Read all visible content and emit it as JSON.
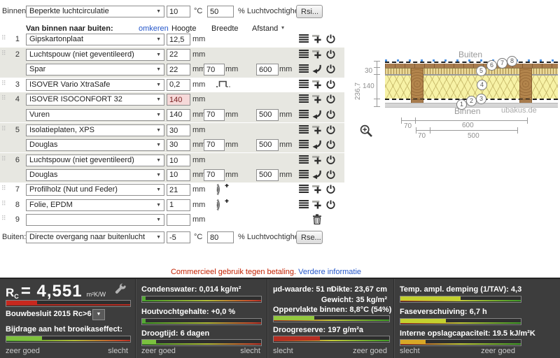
{
  "icons": {
    "select_arrow": "▼",
    "dropdown_arrow": "▼",
    "sort_arrow": "▾",
    "drag_handle": "⠿"
  },
  "binnen": {
    "label": "Binnen:",
    "select": "Beperkte luchtcirculatie",
    "temp": "10",
    "temp_unit": "°C",
    "humidity": "50",
    "humidity_label": "% Luchtvochtigheid",
    "button": "Rsi..."
  },
  "buiten": {
    "label": "Buiten:",
    "select": "Directe overgang naar buitenlucht",
    "temp": "-5",
    "temp_unit": "°C",
    "humidity": "80",
    "humidity_label": "% Luchtvochtigheid",
    "button": "Rse..."
  },
  "columns": {
    "direction": "Van binnen naar buiten:",
    "invert_link": "omkeren",
    "hoogte": "Hoogte",
    "breedte": "Breedte",
    "afstand": "Afstand",
    "unit": "mm"
  },
  "layers": [
    {
      "num": "1",
      "material": "Gipskartonplaat",
      "hoogte": "12,5"
    },
    {
      "num": "2",
      "material": "Luchtspouw (niet geventileerd)",
      "hoogte": "22"
    },
    {
      "num": "",
      "material": "Spar",
      "hoogte": "22",
      "breedte": "70",
      "afstand": "600"
    },
    {
      "num": "3",
      "material": "ISOVER Vario XtraSafe",
      "hoogte": "0,2"
    },
    {
      "num": "4",
      "material": "ISOVER ISOCONFORT 32",
      "hoogte": "140"
    },
    {
      "num": "",
      "material": "Vuren",
      "hoogte": "140",
      "breedte": "70",
      "afstand": "500"
    },
    {
      "num": "5",
      "material": "Isolatieplaten, XPS",
      "hoogte": "30"
    },
    {
      "num": "",
      "material": "Douglas",
      "hoogte": "30",
      "breedte": "70",
      "afstand": "500"
    },
    {
      "num": "6",
      "material": "Luchtspouw (niet geventileerd)",
      "hoogte": "10"
    },
    {
      "num": "",
      "material": "Douglas",
      "hoogte": "10",
      "breedte": "70",
      "afstand": "500"
    },
    {
      "num": "7",
      "material": "Profilholz (Nut und Feder)",
      "hoogte": "21"
    },
    {
      "num": "8",
      "material": "Folie, EPDM",
      "hoogte": "1"
    },
    {
      "num": "9",
      "material": "",
      "hoogte": ""
    }
  ],
  "notice": {
    "text": "Commercieel gebruik tegen betaling.",
    "link": "Verdere informatie"
  },
  "diagram": {
    "outside": "Buiten",
    "inside": "Binnen",
    "watermark": "ubakus.de",
    "total_height": "236,7",
    "dim30": "30",
    "dim140": "140",
    "row1_a": "70",
    "row1_b": "600",
    "row2_a": "70",
    "row2_b": "500",
    "markers": [
      "1",
      "2",
      "3",
      "4",
      "5",
      "6",
      "7",
      "8"
    ]
  },
  "results": {
    "col1": {
      "rc_r": "R",
      "rc_sub": "C",
      "rc_value": "= 4,551",
      "rc_unit": "m²K/W",
      "rc_bar": {
        "pct": "25%",
        "color": "#c8281e"
      },
      "bouwbesluit": "Bouwbesluit 2015 Rc>6",
      "bijdrage": "Bijdrage aan het broeikaseffect:",
      "bijdrage_bar": {
        "pct": "29%",
        "color": "#7fc13d"
      },
      "foot_left": "zeer goed",
      "foot_right": "slecht"
    },
    "col2": {
      "items": [
        {
          "label": "Condenswater: 0,014 kg/m²",
          "pct": "3%",
          "color": "#55a835"
        },
        {
          "label": "Houtvochtgehalte: +0,0 %",
          "pct": "3%",
          "color": "#55a835"
        },
        {
          "label": "Droogtijd: 6 dagen",
          "pct": "12%",
          "color": "#7cc13f"
        }
      ],
      "foot_left": "zeer goed",
      "foot_right": "slecht"
    },
    "col3": {
      "ud": "µd-waarde: 51 m",
      "dikte": "Dikte: 23,67 cm",
      "gewicht": "Gewicht: 35 kg/m²",
      "items": [
        {
          "label": "Oppervlakte binnen: 8,8°C (54%)",
          "pct": "35%",
          "color": "#93c83e"
        },
        {
          "label": "Droogreserve: 197 g/m²a",
          "pct": "40%",
          "color": "#b52e22"
        }
      ],
      "foot_left": "slecht",
      "foot_right": "zeer goed"
    },
    "col4": {
      "items": [
        {
          "label": "Temp. ampl. demping (1/TAV): 4,3",
          "pct": "50%",
          "color": "#c3d02e"
        },
        {
          "label": "Faseverschuiving: 6,7 h",
          "pct": "38%",
          "color": "#c3d02e"
        },
        {
          "label": "Interne opslagcapaciteit: 19.5 kJ/m²K",
          "pct": "21%",
          "color": "#d8a826"
        }
      ],
      "foot_left": "slecht",
      "foot_right": "zeer goed"
    }
  }
}
